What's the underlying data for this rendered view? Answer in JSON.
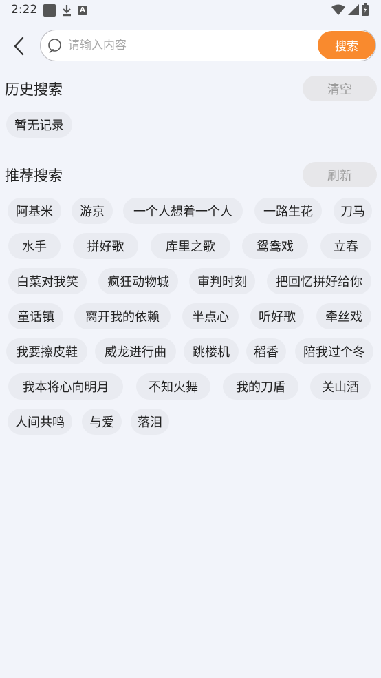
{
  "status": {
    "time": "2:22"
  },
  "search": {
    "placeholder": "请输入内容",
    "button_label": "搜索"
  },
  "history": {
    "title": "历史搜索",
    "clear_label": "清空",
    "empty_text": "暂无记录"
  },
  "recommend": {
    "title": "推荐搜索",
    "refresh_label": "刷新",
    "tags": [
      "阿基米",
      "游京",
      "一个人想着一个人",
      "一路生花",
      "刀马",
      "水手",
      "拼好歌",
      "库里之歌",
      "鸳鸯戏",
      "立春",
      "白菜对我笑",
      "疯狂动物城",
      "审判时刻",
      "把回忆拼好给你",
      "童话镇",
      "离开我的依赖",
      "半点心",
      "听好歌",
      "牵丝戏",
      "我要擦皮鞋",
      "威龙进行曲",
      "跳楼机",
      "稻香",
      "陪我过个冬",
      "我本将心向明月",
      "不知火舞",
      "我的刀盾",
      "关山酒",
      "人间共鸣",
      "与爱",
      "落泪"
    ]
  }
}
